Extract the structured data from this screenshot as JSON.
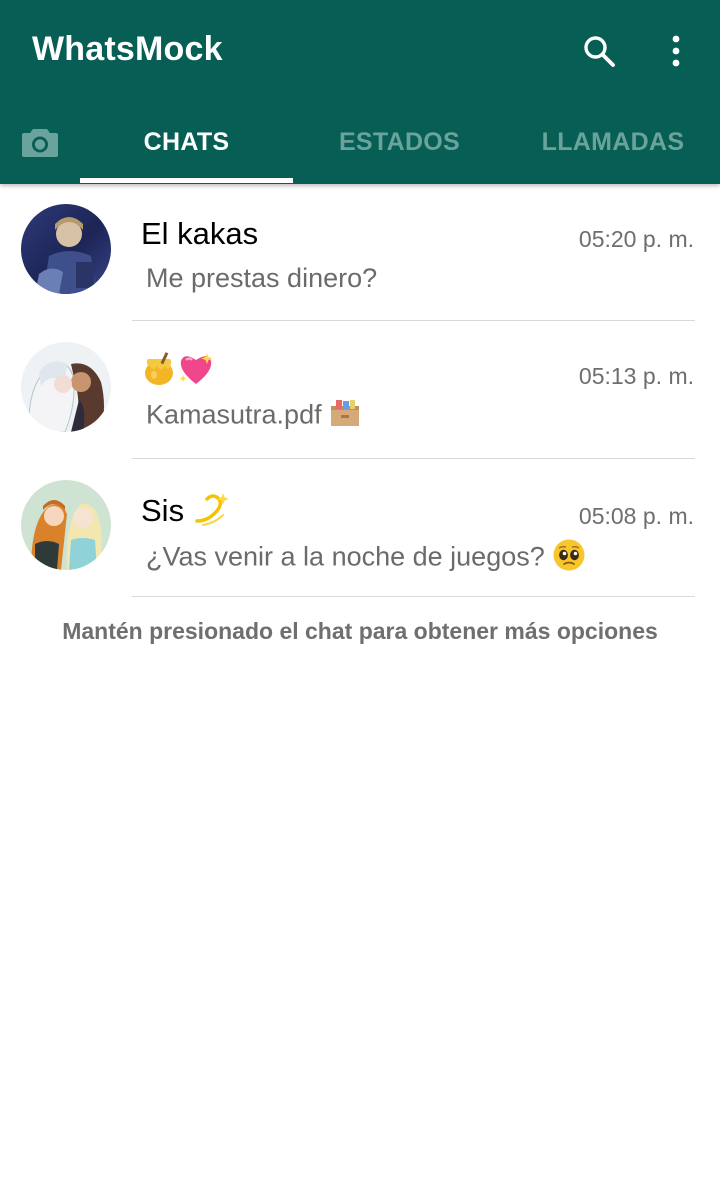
{
  "app": {
    "title": "WhatsMock",
    "colors": {
      "primary": "#075e54",
      "tab_inactive": "#6aa39b",
      "text_secondary": "#6b6b6b"
    }
  },
  "toolbar": {
    "search_icon": "search-icon",
    "menu_icon": "more-vert-icon"
  },
  "tabs": {
    "camera_icon": "camera-icon",
    "items": [
      {
        "label": "CHATS",
        "active": true
      },
      {
        "label": "ESTADOS",
        "active": false
      },
      {
        "label": "LLAMADAS",
        "active": false
      }
    ]
  },
  "chats": [
    {
      "name": "El kakas",
      "time": "05:20 p. m.",
      "preview": "Me prestas dinero?"
    },
    {
      "name": "🍯💖",
      "name_emojis": [
        "honey-pot-emoji",
        "sparkling-heart-emoji"
      ],
      "time": "05:13 p. m.",
      "preview": "Kamasutra.pdf",
      "preview_emoji": "card-file-box-emoji"
    },
    {
      "name": "Sis",
      "name_emoji": "dizzy-emoji",
      "time": "05:08 p. m.",
      "preview": "¿Vas venir a la noche de juegos?",
      "preview_emoji": "pleading-face-emoji"
    }
  ],
  "hint": "Mantén presionado el chat para obtener más opciones"
}
